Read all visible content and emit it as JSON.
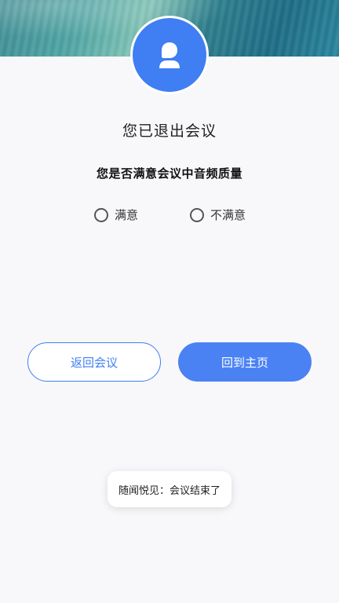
{
  "header": {
    "status_title": "您已退出会议"
  },
  "survey": {
    "question": "您是否满意会议中音频质量",
    "options": [
      {
        "label": "满意",
        "selected": false
      },
      {
        "label": "不满意",
        "selected": false
      }
    ]
  },
  "actions": {
    "return_label": "返回会议",
    "home_label": "回到主页"
  },
  "toast": {
    "text": "随闻悦见：会议结束了"
  },
  "icons": {
    "avatar": "user-icon"
  },
  "colors": {
    "accent": "#3f7ef3",
    "primary_button": "#4a82f4"
  }
}
